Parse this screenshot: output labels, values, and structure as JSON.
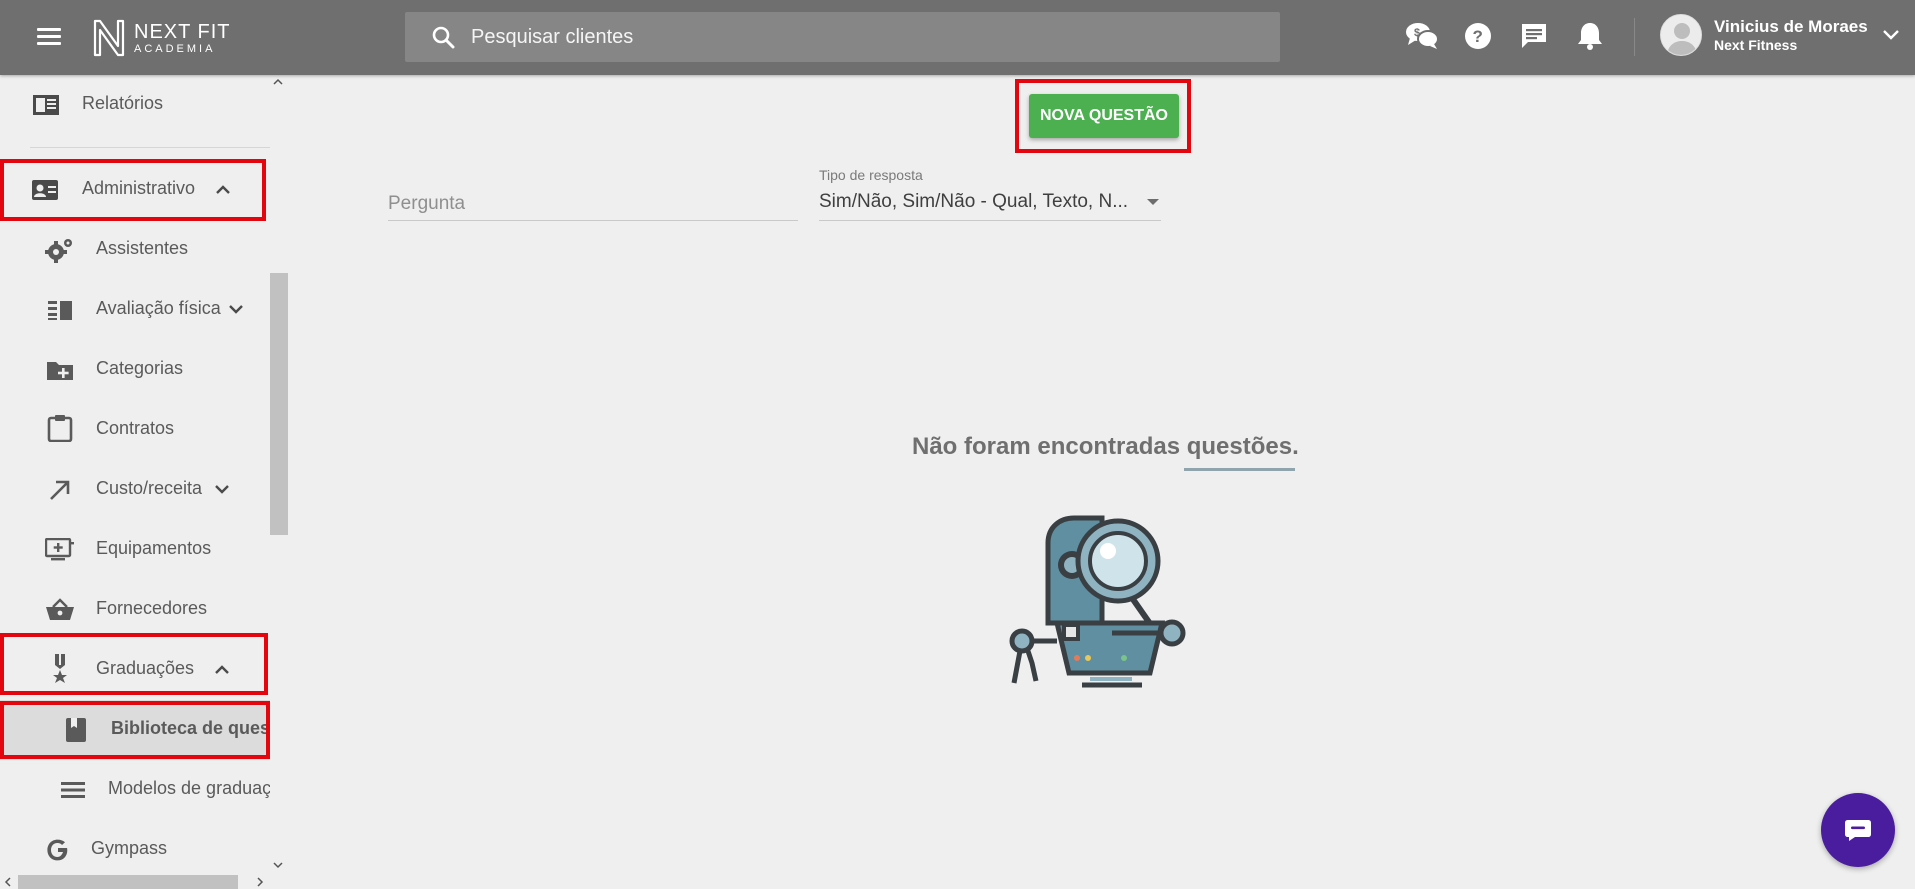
{
  "header": {
    "logo_line1": "NEXT FIT",
    "logo_line2": "ACADEMIA",
    "search_placeholder": "Pesquisar clientes",
    "icons": [
      "chat-money-icon",
      "help-icon",
      "message-icon",
      "notification-bell-icon"
    ],
    "user_name": "Vinicius de Moraes",
    "user_company": "Next Fitness"
  },
  "sidebar": {
    "items": [
      {
        "label": "Relatórios",
        "icon": "report-icon"
      },
      {
        "label": "Administrativo",
        "icon": "id-card-icon"
      },
      {
        "label": "Assistentes",
        "icon": "gears-icon"
      },
      {
        "label": "Avaliação física",
        "icon": "list-icon"
      },
      {
        "label": "Categorias",
        "icon": "folder-add-icon"
      },
      {
        "label": "Contratos",
        "icon": "clipboard-icon"
      },
      {
        "label": "Custo/receita",
        "icon": "arrow-up-right-icon"
      },
      {
        "label": "Equipamentos",
        "icon": "monitor-add-icon"
      },
      {
        "label": "Fornecedores",
        "icon": "basket-icon"
      },
      {
        "label": "Graduações",
        "icon": "medal-icon"
      },
      {
        "label": "Biblioteca de questõe",
        "icon": "book-icon"
      },
      {
        "label": "Modelos de graduaçã",
        "icon": "lines-icon"
      },
      {
        "label": "Gympass",
        "icon": "google-g-icon"
      }
    ]
  },
  "main": {
    "new_question_button": "NOVA QUESTÃO",
    "question_field_placeholder": "Pergunta",
    "answer_type_label": "Tipo de resposta",
    "answer_type_value": "Sim/Não, Sim/Não - Qual, Texto, N...",
    "empty_message": "Não foram encontradas questões."
  },
  "colors": {
    "topbar": "#6f6f6f",
    "accent_green": "#4caf50",
    "highlight_red": "#e3060f",
    "chat_purple": "#4a1d9e"
  }
}
